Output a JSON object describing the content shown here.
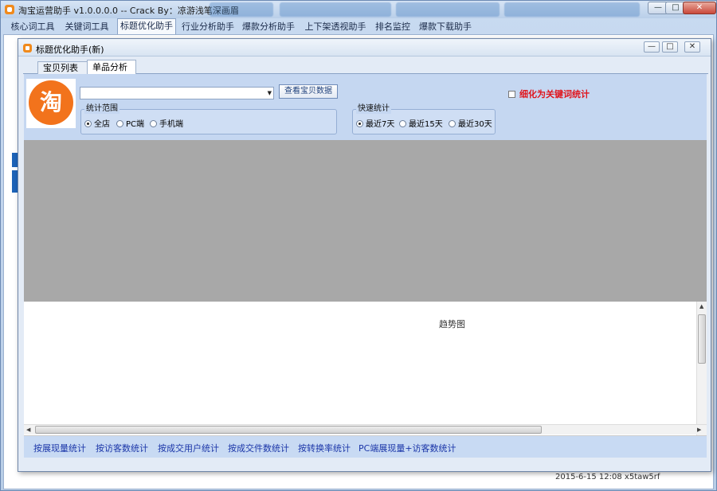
{
  "main_window": {
    "title": "淘宝运营助手 v1.0.0.0.0 -- Crack By：凉游浅笔深画眉",
    "minimize": "—",
    "maximize": "□",
    "close": "✕",
    "tabs": [
      "核心词工具",
      "关键词工具",
      "标题优化助手",
      "行业分析助手",
      "爆款分析助手",
      "上下架透视助手",
      "排名监控",
      "爆款下载助手"
    ],
    "bottom_date": "2015-6-15 12:08 x5taw5rf"
  },
  "dialog": {
    "title": "标题优化助手(新)",
    "minimize": "—",
    "maximize": "□",
    "close": "✕",
    "tabs": [
      "宝贝列表",
      "单品分析"
    ],
    "logo_text": "淘",
    "shop_select_value": "",
    "view_button": "查看宝贝数据",
    "stat_range": {
      "legend": "统计范围",
      "options": [
        "全店",
        "PC端",
        "手机端"
      ],
      "selected": "全店"
    },
    "quick_stat": {
      "legend": "快速统计",
      "options": [
        "最近7天",
        "最近15天",
        "最近30天"
      ],
      "selected": "最近7天"
    },
    "refine_checkbox": {
      "label": "细化为关键词统计",
      "checked": false
    },
    "chart_title": "趋势图",
    "stat_links": [
      "按展现量统计",
      "按访客数统计",
      "按成交用户统计",
      "按成交件数统计",
      "按转换率统计",
      "PC端展现量+访客数统计"
    ]
  },
  "colors": {
    "accent_orange": "#f2731c",
    "panel_blue": "#c5d7f1",
    "link_blue": "#1a35a8",
    "warning_red": "#e0141c",
    "placeholder_gray": "#a8a8a8"
  }
}
